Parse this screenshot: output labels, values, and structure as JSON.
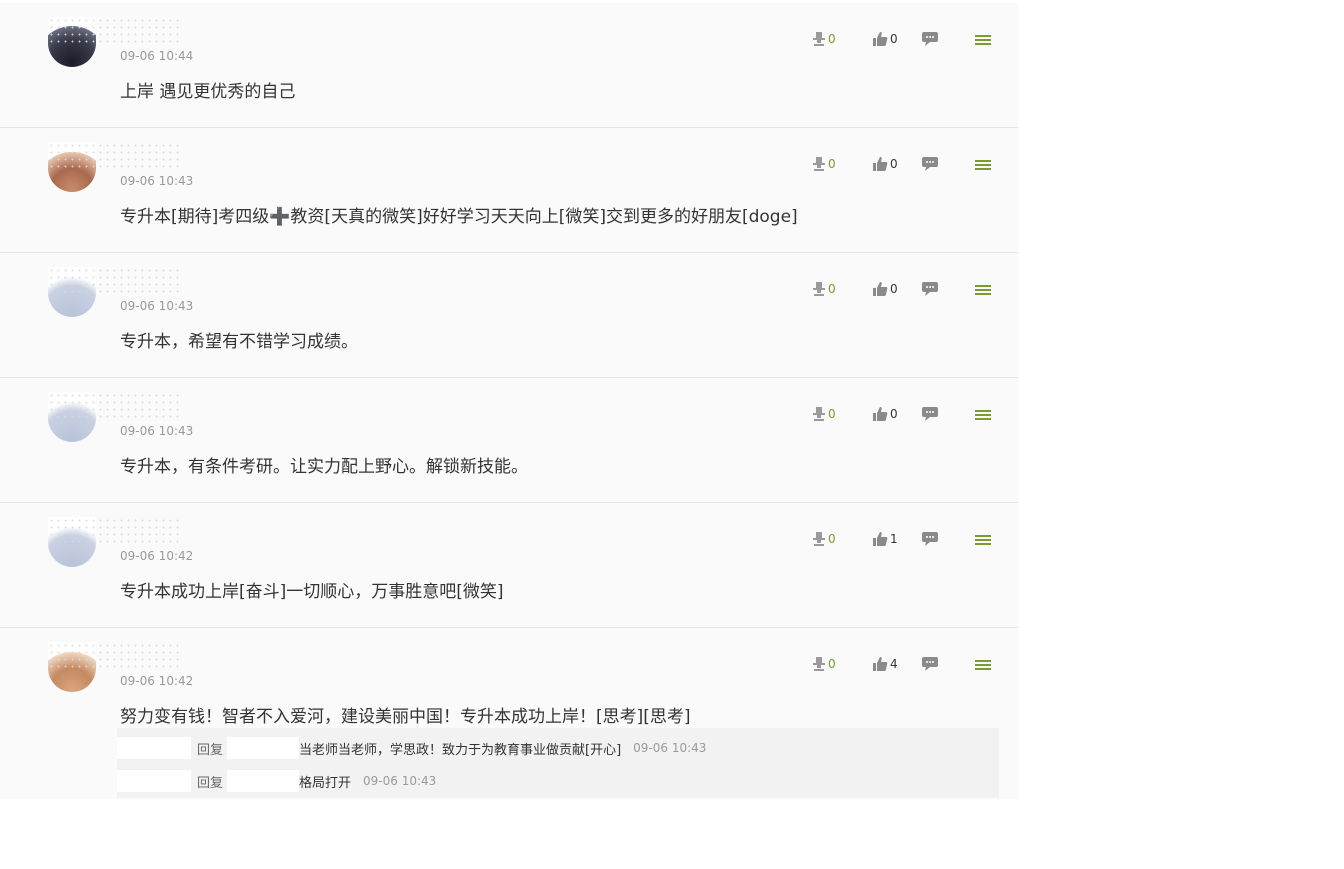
{
  "comments": [
    {
      "time": "09-06 10:44",
      "text": "上岸 遇见更优秀的自己",
      "hat_count": "0",
      "like_count": "0"
    },
    {
      "time": "09-06 10:43",
      "text": "专升本[期待]考四级➕教资[天真的微笑]好好学习天天向上[微笑]交到更多的好朋友[doge]",
      "hat_count": "0",
      "like_count": "0"
    },
    {
      "time": "09-06 10:43",
      "text": "专升本，希望有不错学习成绩。",
      "hat_count": "0",
      "like_count": "0"
    },
    {
      "time": "09-06 10:43",
      "text": "专升本，有条件考研。让实力配上野心。解锁新技能。",
      "hat_count": "0",
      "like_count": "0"
    },
    {
      "time": "09-06 10:42",
      "text": "专升本成功上岸[奋斗]一切顺心，万事胜意吧[微笑]",
      "hat_count": "0",
      "like_count": "1"
    },
    {
      "time": "09-06 10:42",
      "text": "努力变有钱！智者不入爱河，建设美丽中国！专升本成功上岸！[思考][思考]",
      "hat_count": "0",
      "like_count": "4"
    }
  ],
  "replies": [
    {
      "label": "回复",
      "text": "当老师当老师，学思政！致力于为教育事业做贡献[开心]",
      "time": "09-06 10:43"
    },
    {
      "label": "回复",
      "text": "格局打开",
      "time": "09-06 10:43"
    }
  ],
  "icons": {
    "hat": "hat-icon",
    "like": "thumbs-up-icon",
    "reply": "reply-icon",
    "menu": "menu-icon"
  },
  "colors": {
    "accent": "#7a9c2f",
    "text": "#333333",
    "muted": "#9a9a9a",
    "background": "#fafafa"
  }
}
